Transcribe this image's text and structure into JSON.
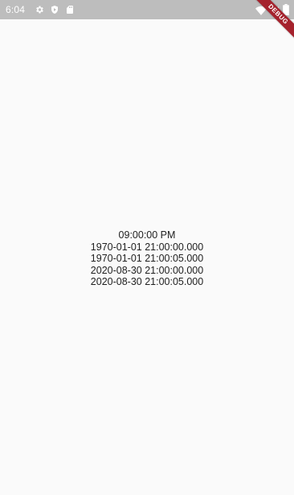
{
  "status_bar": {
    "time": "6:04",
    "icons_left": [
      "gear-icon",
      "shield-play-icon",
      "sd-card-icon"
    ],
    "icons_right": [
      "wifi-icon",
      "signal-icon",
      "battery-icon"
    ]
  },
  "debug_banner": {
    "label": "DEBUG",
    "color": "#a5222d"
  },
  "content": {
    "lines": [
      "09:00:00 PM",
      "1970-01-01 21:00:00.000",
      "1970-01-01 21:00:05.000",
      "2020-08-30 21:00:00.000",
      "2020-08-30 21:00:05.000"
    ]
  },
  "colors": {
    "status_bar": "#bdbdbd",
    "background": "#fafafa",
    "text": "#212121"
  }
}
